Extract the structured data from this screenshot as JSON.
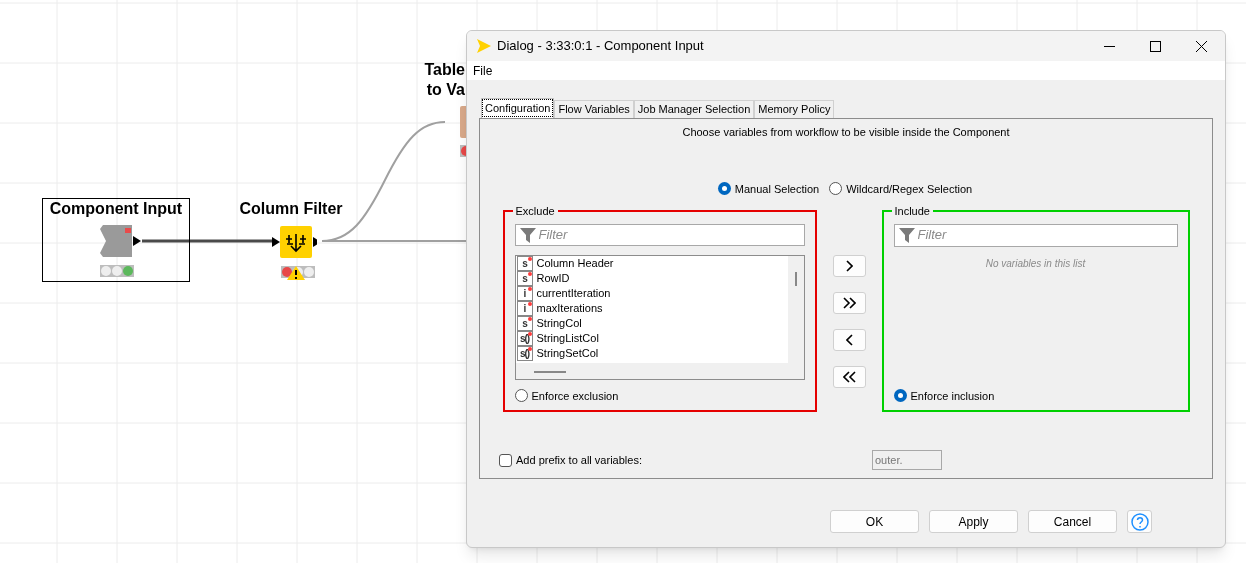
{
  "canvas": {
    "nodes": [
      {
        "kind": "component",
        "label": [
          "Component Input"
        ],
        "selected": true,
        "lights": [
          {
            "color": "#eeeeee"
          },
          {
            "color": "#eeeeee"
          },
          {
            "color": "#5cb85c"
          }
        ],
        "warning": false
      },
      {
        "kind": "filter",
        "label": [
          "Column Filter"
        ],
        "selected": false,
        "lights": [
          {
            "color": "#e84848"
          },
          {
            "color": "#eeeeee"
          },
          {
            "color": "#eeeeee"
          }
        ],
        "warning": true
      },
      {
        "kind": "converter",
        "label": [
          "Table",
          "to Va"
        ],
        "lights": [
          {
            "color": "#e84848"
          }
        ]
      }
    ]
  },
  "dialog": {
    "title": "Dialog - 3:33:0:1 - Component Input",
    "menu": [
      "File"
    ],
    "tabs": [
      {
        "label": "Configuration",
        "selected": true
      },
      {
        "label": "Flow Variables",
        "selected": false
      },
      {
        "label": "Job Manager Selection",
        "selected": false
      },
      {
        "label": "Memory Policy",
        "selected": false
      }
    ],
    "description": "Choose variables from workflow to be visible inside the Component",
    "modes": [
      {
        "label": "Manual Selection",
        "selected": true
      },
      {
        "label": "Wildcard/Regex Selection",
        "selected": false
      }
    ],
    "exclude": {
      "title": "Exclude",
      "filter_placeholder": "Filter",
      "items": [
        {
          "type": "s",
          "name": "Column Header"
        },
        {
          "type": "s",
          "name": "RowID"
        },
        {
          "type": "i",
          "name": "currentIteration"
        },
        {
          "type": "i",
          "name": "maxIterations"
        },
        {
          "type": "s",
          "name": "StringCol"
        },
        {
          "type": "s()",
          "name": "StringListCol"
        },
        {
          "type": "s()",
          "name": "StringSetCol"
        }
      ],
      "enforce": {
        "label": "Enforce exclusion",
        "selected": false
      }
    },
    "include": {
      "title": "Include",
      "filter_placeholder": "Filter",
      "empty_text": "No variables in this list",
      "enforce": {
        "label": "Enforce inclusion",
        "selected": true
      }
    },
    "prefix": {
      "label": "Add prefix to all variables:",
      "checked": false,
      "value": "outer."
    },
    "buttons": [
      "OK",
      "Apply",
      "Cancel"
    ]
  }
}
